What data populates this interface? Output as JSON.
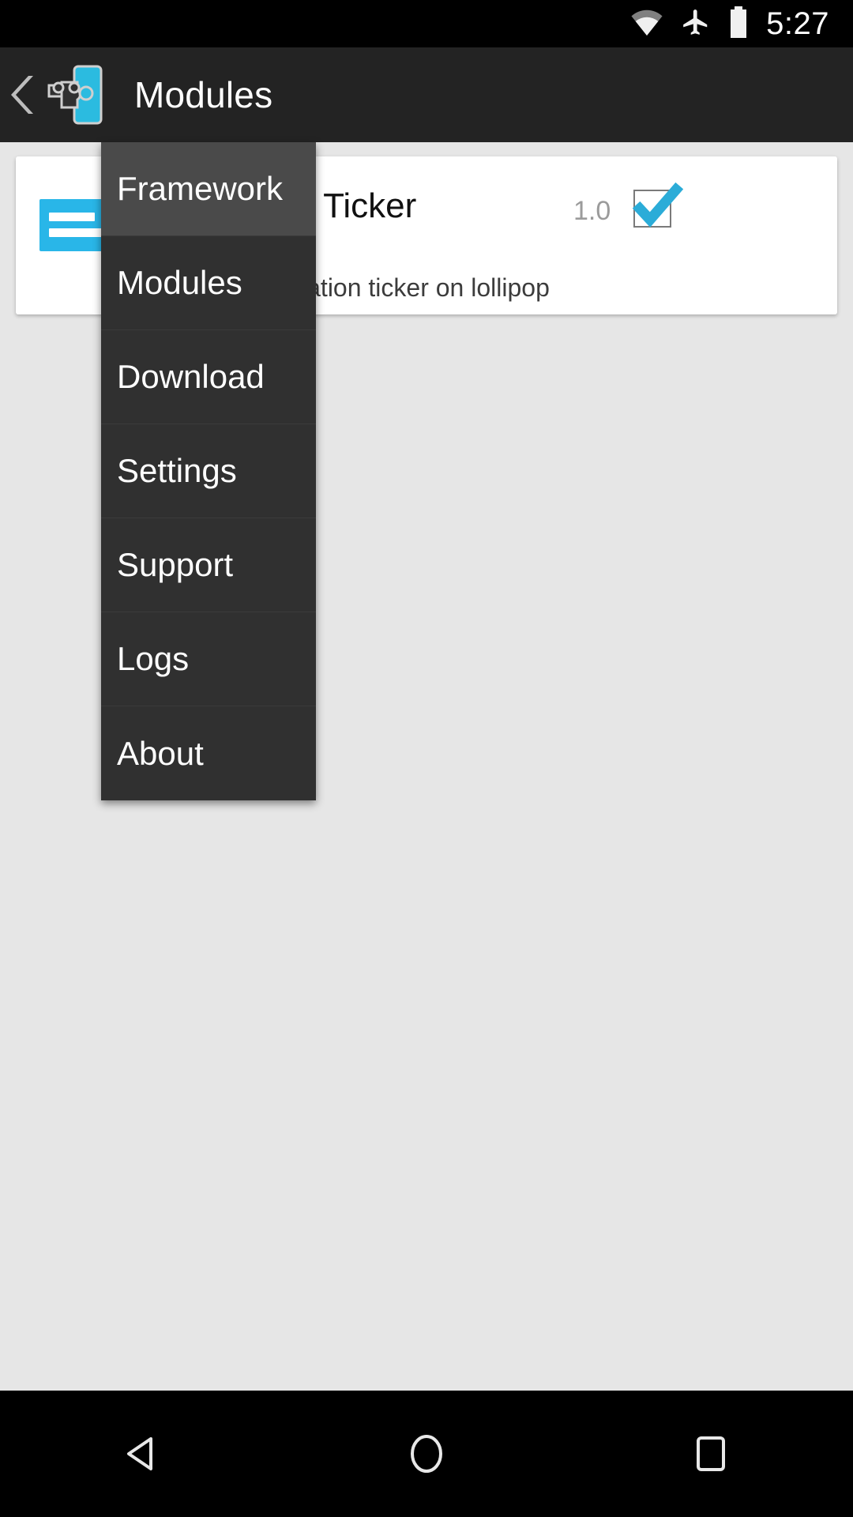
{
  "status_bar": {
    "time": "5:27",
    "icons": [
      "wifi-icon",
      "airplane-mode-icon",
      "battery-icon"
    ]
  },
  "app_bar": {
    "back_label": "",
    "logo_name": "xposed-installer-logo",
    "title": "Modules",
    "spinner_caret": "dropdown-caret-icon"
  },
  "dropdown_menu": {
    "items": [
      {
        "label": "Framework",
        "selected": true
      },
      {
        "label": "Modules",
        "selected": false
      },
      {
        "label": "Download",
        "selected": false
      },
      {
        "label": "Settings",
        "selected": false
      },
      {
        "label": "Support",
        "selected": false
      },
      {
        "label": "Logs",
        "selected": false
      },
      {
        "label": "About",
        "selected": false
      }
    ]
  },
  "module_card": {
    "icon_name": "notification-ticker-module-icon",
    "title": "Notification Ticker",
    "version": "1.0",
    "description": "Enables notification ticker on lollipop",
    "checkbox_checked": true
  },
  "nav_bar": {
    "back": "back-nav-icon",
    "home": "home-nav-icon",
    "recents": "recents-nav-icon"
  },
  "colors": {
    "accent": "#29b6e8",
    "appbar": "#232323",
    "menu_bg": "#303030",
    "menu_selected": "#4a4a4a",
    "page_bg": "#e6e6e6",
    "version_text": "#9b9b9b"
  }
}
